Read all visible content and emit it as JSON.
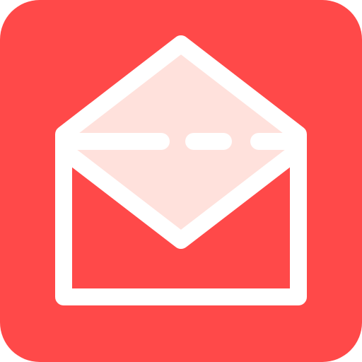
{
  "app_icon": {
    "name": "open-envelope-icon",
    "colors": {
      "background": "#FF4949",
      "stroke": "#FFFFFF",
      "letter_fill": "#FFE1DC"
    }
  }
}
